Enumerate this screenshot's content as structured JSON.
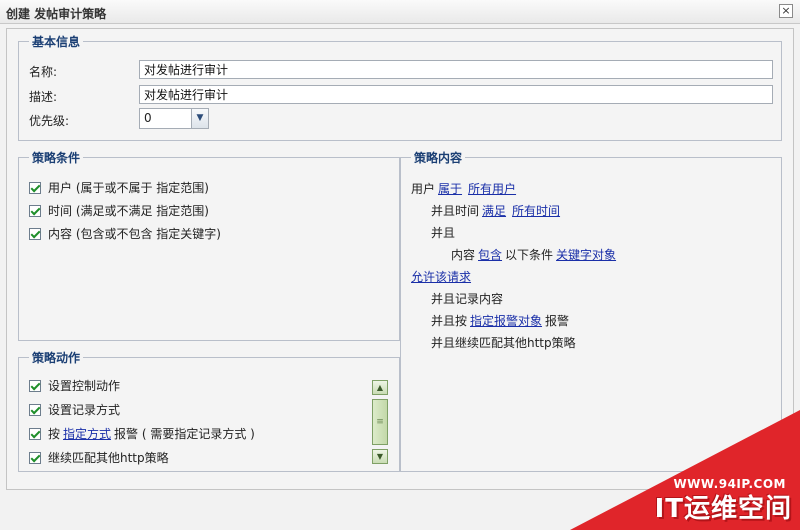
{
  "window": {
    "title": "创建 发帖审计策略",
    "close_label": "×"
  },
  "basic_info": {
    "legend": "基本信息",
    "name_label": "名称:",
    "name_value": "对发帖进行审计",
    "desc_label": "描述:",
    "desc_value": "对发帖进行审计",
    "priority_label": "优先级:",
    "priority_value": "0"
  },
  "conditions": {
    "legend": "策略条件",
    "items": [
      {
        "label": "用户 (属于或不属于 指定范围)",
        "checked": true
      },
      {
        "label": "时间 (满足或不满足 指定范围)",
        "checked": true
      },
      {
        "label": "内容 (包含或不包含 指定关键字)",
        "checked": true
      }
    ]
  },
  "actions": {
    "legend": "策略动作",
    "items": [
      {
        "label": "设置控制动作",
        "checked": true
      },
      {
        "label": "设置记录方式",
        "checked": true
      },
      {
        "prefix": "按",
        "link": "指定方式",
        "suffix": "报警 ( 需要指定记录方式 )",
        "checked": true
      },
      {
        "label": "继续匹配其他http策略",
        "checked": true
      }
    ]
  },
  "content": {
    "legend": "策略内容",
    "line1": {
      "text": "用户",
      "link1": "属于",
      "link2": "所有用户"
    },
    "line2": {
      "text": "并且时间",
      "link1": "满足",
      "link2": "所有时间"
    },
    "line3": {
      "text": "并且"
    },
    "line4": {
      "text": "内容",
      "link1": "包含",
      "mid": "以下条件",
      "link2": "关键字对象"
    },
    "line5": {
      "link": "允许该请求"
    },
    "line6": {
      "text": "并且记录内容"
    },
    "line7": {
      "text": "并且按",
      "link": "指定报警对象",
      "suffix": "报警"
    },
    "line8": {
      "text": "并且继续匹配其他http策略"
    }
  },
  "watermark": {
    "url": "WWW.94IP.COM",
    "brand": "IT运维空间"
  },
  "colors": {
    "legend": "#1b3f74",
    "link": "#1a2fa8",
    "watermark": "#e0252a",
    "check": "#1f8f2a"
  }
}
